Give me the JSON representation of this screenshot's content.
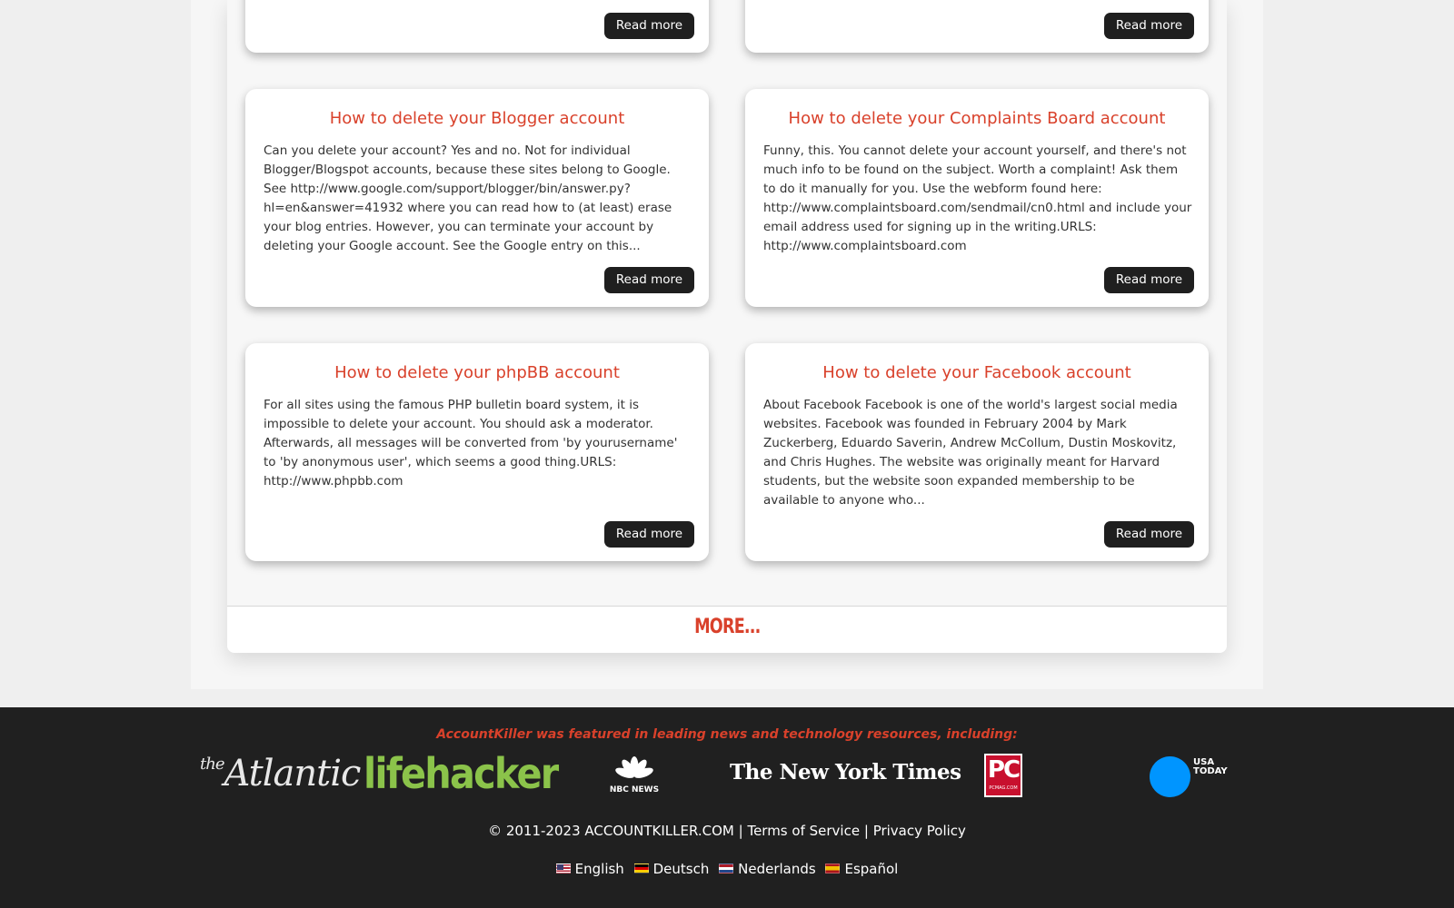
{
  "cards": [
    {
      "title": "",
      "text": "",
      "read_more": "Read more"
    },
    {
      "title": "",
      "text": "",
      "read_more": "Read more"
    },
    {
      "title": "How to delete your Blogger account",
      "text": "Can you delete your account? Yes and no. Not for individual Blogger/Blogspot accounts, because these sites belong to Google. See http://www.google.com/support/blogger/bin/answer.py?hl=en&answer=41932 where you can read how to (at least) erase your blog entries. However, you can terminate your account by deleting your Google account. See the Google entry on this...",
      "read_more": "Read more"
    },
    {
      "title": "How to delete your Complaints Board account",
      "text": "Funny, this. You cannot delete your account yourself, and there's not much info to be found on the subject. Worth a complaint! Ask them to do it manually for you. Use the webform found here: http://www.complaintsboard.com/sendmail/cn0.html and include your email address used for signing up in the writing.URLS: http://www.complaintsboard.com",
      "read_more": "Read more"
    },
    {
      "title": "How to delete your phpBB account",
      "text": "For all sites using the famous PHP bulletin board system, it is impossible to delete your account. You should ask a moderator. Afterwards, all messages will be converted from 'by yourusername' to 'by anonymous user', which seems a good thing.URLS: http://www.phpbb.com",
      "read_more": "Read more"
    },
    {
      "title": "How to delete your Facebook account",
      "text": "About Facebook Facebook is one of the world's largest social media websites. Facebook was founded in February 2004 by Mark Zuckerberg, Eduardo Saverin, Andrew McCollum, Dustin Moskovitz, and Chris Hughes. The website was originally meant for Harvard students, but the website soon expanded membership to be available to anyone who...",
      "read_more": "Read more"
    }
  ],
  "more_link": "MORE...",
  "footer": {
    "featured": "AccountKiller was featured in leading news and technology resources, including:",
    "logos": {
      "atlantic_the": "the",
      "atlantic_name": "Atlantic",
      "lifehacker_life": "life",
      "lifehacker_hacker": "hacker",
      "nbc": "NBC NEWS",
      "nyt": "The New York Times",
      "pc_big": "PC",
      "pc_small": "PCMAG.COM",
      "usa_line1": "USA",
      "usa_line2": "TODAY"
    },
    "copyright": "© 2011-2023 ACCOUNTKILLER.COM",
    "separator": "|",
    "terms": "Terms of Service",
    "privacy": "Privacy Policy",
    "languages": [
      "English",
      "Deutsch",
      "Nederlands",
      "Español"
    ]
  },
  "colors": {
    "accent": "#d9412b",
    "footer_bg": "#202020",
    "button_bg": "#1f1f1f"
  }
}
